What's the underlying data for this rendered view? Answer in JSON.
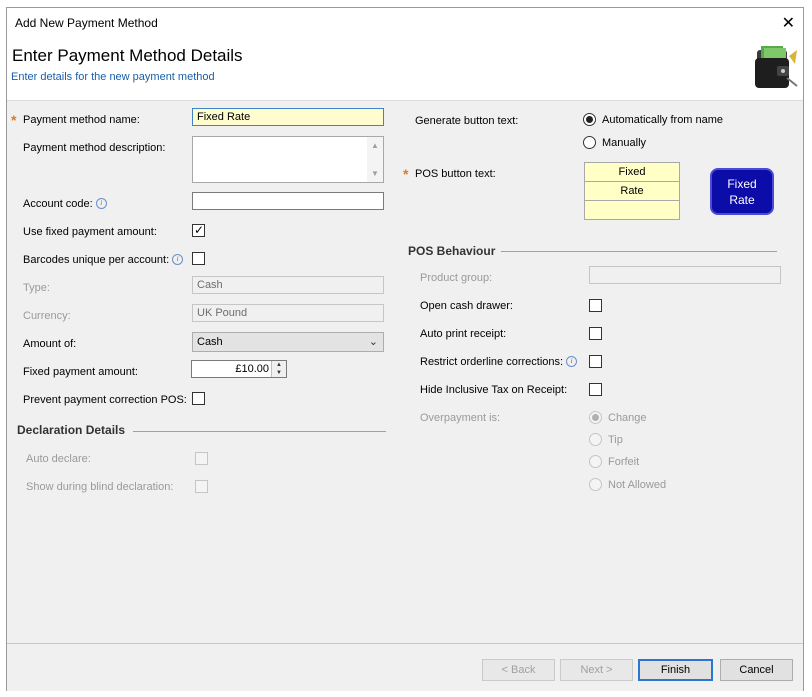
{
  "window": {
    "title": "Add New Payment Method",
    "close_glyph": "✕"
  },
  "header": {
    "title": "Enter Payment Method Details",
    "subtitle": "Enter details for the new payment method",
    "icon": "wallet-icon"
  },
  "left": {
    "name_label": "Payment method name:",
    "name_value": "Fixed Rate",
    "description_label": "Payment method description:",
    "description_value": "",
    "account_code_label": "Account code:",
    "account_code_value": "",
    "use_fixed_label": "Use fixed payment amount:",
    "use_fixed_checked": true,
    "barcodes_label": "Barcodes unique per account:",
    "barcodes_checked": false,
    "type_label": "Type:",
    "type_value": "Cash",
    "currency_label": "Currency:",
    "currency_value": "UK Pound",
    "amount_of_label": "Amount of:",
    "amount_of_value": "Cash",
    "fixed_amount_label": "Fixed payment amount:",
    "fixed_amount_value": "£10.00",
    "prevent_correction_label": "Prevent payment correction POS:",
    "prevent_correction_checked": false
  },
  "declaration": {
    "title": "Declaration Details",
    "auto_declare_label": "Auto declare:",
    "blind_label": "Show during blind declaration:"
  },
  "right": {
    "generate_label": "Generate button text:",
    "auto_option": "Automatically from name",
    "manual_option": "Manually",
    "selected": "auto",
    "pos_text_label": "POS button text:",
    "pos_text_lines": [
      "Fixed",
      "Rate",
      ""
    ],
    "preview_lines": [
      "Fixed",
      "Rate"
    ],
    "preview_color": "#0c0ca8"
  },
  "pos_behaviour": {
    "title": "POS Behaviour",
    "product_group_label": "Product group:",
    "product_group_value": "",
    "open_drawer_label": "Open cash drawer:",
    "auto_print_label": "Auto print receipt:",
    "restrict_label": "Restrict orderline corrections:",
    "hide_tax_label": "Hide Inclusive Tax on Receipt:",
    "overpayment_label": "Overpayment is:",
    "overpayment_options": [
      "Change",
      "Tip",
      "Forfeit",
      "Not Allowed"
    ],
    "overpayment_selected": "Change"
  },
  "footer": {
    "back_label": "< Back",
    "next_label": "Next >",
    "finish_label": "Finish",
    "cancel_label": "Cancel"
  },
  "colors": {
    "required": "#e07a1e",
    "link_blue": "#1a5fa8",
    "focus_border": "#3d86c6"
  }
}
